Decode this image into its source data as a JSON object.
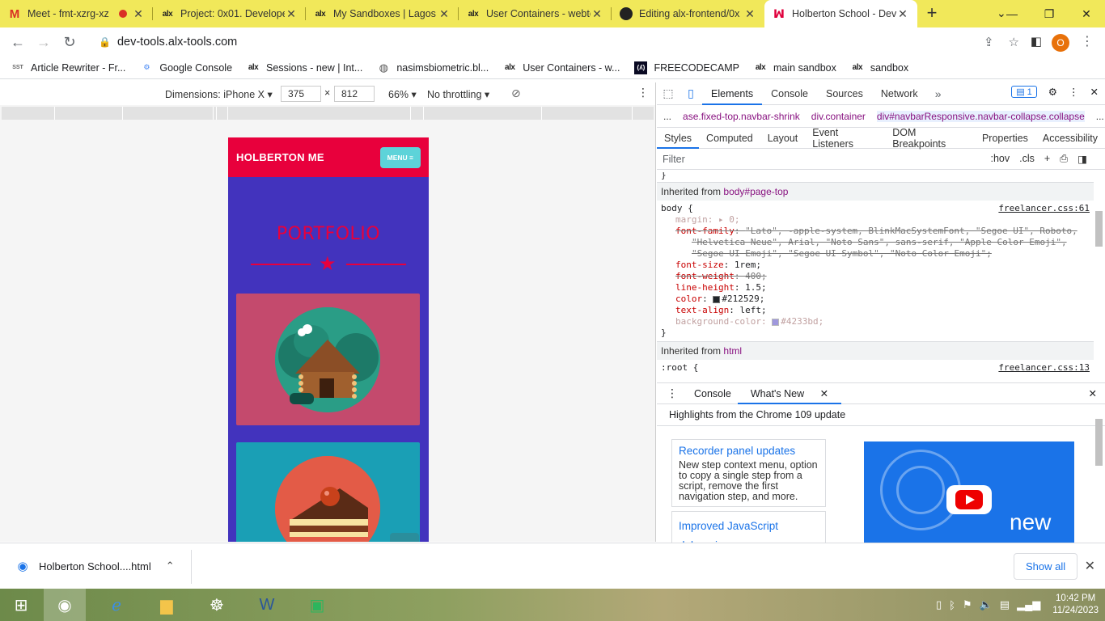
{
  "browser": {
    "tabs": [
      {
        "title": "Meet - fmt-xzrg-xz",
        "favicon": "gmail-meet-icon",
        "recording": true
      },
      {
        "title": "Project: 0x01. Develope",
        "favicon": "alx-icon"
      },
      {
        "title": "My Sandboxes | Lagos",
        "favicon": "alx-icon"
      },
      {
        "title": "User Containers - webte",
        "favicon": "alx-icon"
      },
      {
        "title": "Editing alx-frontend/0x",
        "favicon": "github-icon"
      },
      {
        "title": "Holberton School - Dev",
        "favicon": "holberton-icon",
        "active": true
      }
    ],
    "new_tab": "+",
    "url": "dev-tools.alx-tools.com",
    "profile_initial": "O",
    "bookmarks": [
      {
        "label": "Article Rewriter - Fr...",
        "icon": "sst"
      },
      {
        "label": "Google Console",
        "icon": "google-console"
      },
      {
        "label": "Sessions - new | Int...",
        "icon": "alx"
      },
      {
        "label": "nasimsbiometric.bl...",
        "icon": "globe"
      },
      {
        "label": "User Containers - w...",
        "icon": "alx"
      },
      {
        "label": "FREECODECAMP",
        "icon": "freecodecamp"
      },
      {
        "label": "main sandbox",
        "icon": "alx"
      },
      {
        "label": "sandbox",
        "icon": "alx"
      }
    ]
  },
  "device_toolbar": {
    "dimensions_label": "Dimensions: iPhone X",
    "width": "375",
    "height": "812",
    "times": "×",
    "zoom": "66%",
    "throttling": "No throttling"
  },
  "phone": {
    "brand": "HOLBERTON ME",
    "menu": "MENU ≡",
    "heading": "PORTFOLIO",
    "card_colors": [
      "#c44a6d",
      "#1a9fb5"
    ]
  },
  "devtools": {
    "tabs": [
      "Elements",
      "Console",
      "Sources",
      "Network"
    ],
    "active_tab": "Elements",
    "issues_count": "1",
    "breadcrumbs": [
      {
        "text": "...",
        "plain": true
      },
      {
        "text": "ase.fixed-top.navbar-shrink"
      },
      {
        "text": "div.container"
      },
      {
        "text": "div#navbarResponsive.navbar-collapse.collapse"
      },
      {
        "text": "...",
        "plain": true
      }
    ],
    "subtabs": [
      "Styles",
      "Computed",
      "Layout",
      "Event Listeners",
      "DOM Breakpoints",
      "Properties",
      "Accessibility"
    ],
    "filter_placeholder": "Filter",
    "filter_tools": [
      ":hov",
      ".cls",
      "+"
    ],
    "inherited_body_label": "Inherited from",
    "inherited_body_selector": "body#page-top",
    "body_rule": {
      "selector": "body {",
      "source": "freelancer.css:61",
      "margin_name": "margin",
      "margin_value": "▸ 0;",
      "font_family_name": "font-family",
      "font_family_value": "\"Lato\", -apple-system, BlinkMacSystemFont, \"Segoe UI\", Roboto,",
      "font_family_value_2": "\"Helvetica Neue\", Arial, \"Noto Sans\", sans-serif, \"Apple Color Emoji\",",
      "font_family_value_3": "\"Segoe UI Emoji\", \"Segoe UI Symbol\", \"Noto Color Emoji\";",
      "font_size_name": "font-size",
      "font_size_value": "1rem;",
      "font_weight_name": "font-weight",
      "font_weight_value": "400;",
      "line_height_name": "line-height",
      "line_height_value": "1.5;",
      "color_name": "color",
      "color_value": "#212529;",
      "text_align_name": "text-align",
      "text_align_value": "left;",
      "bg_name": "background-color",
      "bg_value": "#4233bd;",
      "close": "}"
    },
    "inherited_html_label": "Inherited from",
    "inherited_html_selector": "html",
    "root_rule": {
      "selector": ":root {",
      "source": "freelancer.css:13"
    },
    "drawer_tabs": [
      "Console",
      "What's New"
    ],
    "highlights": "Highlights from the Chrome 109 update",
    "whats_new_cards": [
      {
        "title": "Recorder panel updates",
        "desc": "New step context menu, option to copy a single step from a script, remove the first navigation step, and more."
      },
      {
        "title": "Improved JavaScript debugging",
        "desc": ""
      }
    ],
    "promo_text": "new"
  },
  "downloads": {
    "file": "Holberton School....html",
    "show_all": "Show all"
  },
  "taskbar": {
    "time": "10:42 PM",
    "date": "11/24/2023"
  },
  "colors": {
    "tabbar": "#f1e85a",
    "phone_bg": "#4233bd",
    "phone_nav": "#e8003c",
    "accent": "#1a73e8"
  }
}
